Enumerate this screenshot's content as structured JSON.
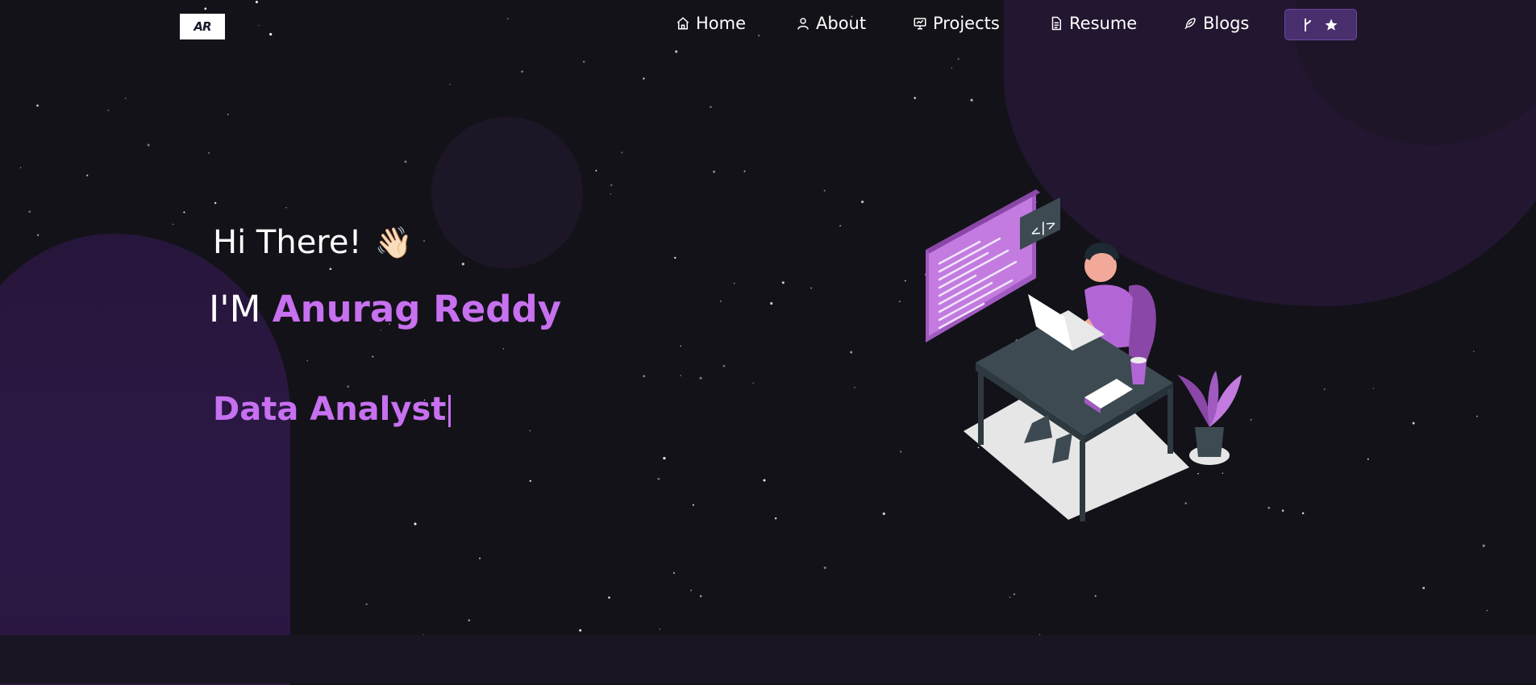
{
  "nav": {
    "logo": "AR",
    "items": [
      {
        "label": "Home",
        "icon": "home-icon"
      },
      {
        "label": "About",
        "icon": "user-icon"
      },
      {
        "label": "Projects",
        "icon": "presentation-icon"
      },
      {
        "label": "Resume",
        "icon": "document-icon"
      },
      {
        "label": "Blogs",
        "icon": "feather-icon"
      }
    ],
    "fork_button_icons": [
      "git-fork-icon",
      "star-icon"
    ]
  },
  "hero": {
    "greeting": "Hi There!",
    "wave": "👋🏻",
    "name_prefix": "I'M ",
    "name": "Anurag Reddy",
    "role": "Data Analyst"
  },
  "colors": {
    "accent": "#c770f0",
    "background": "#131218",
    "button": "#4a2f6e"
  }
}
